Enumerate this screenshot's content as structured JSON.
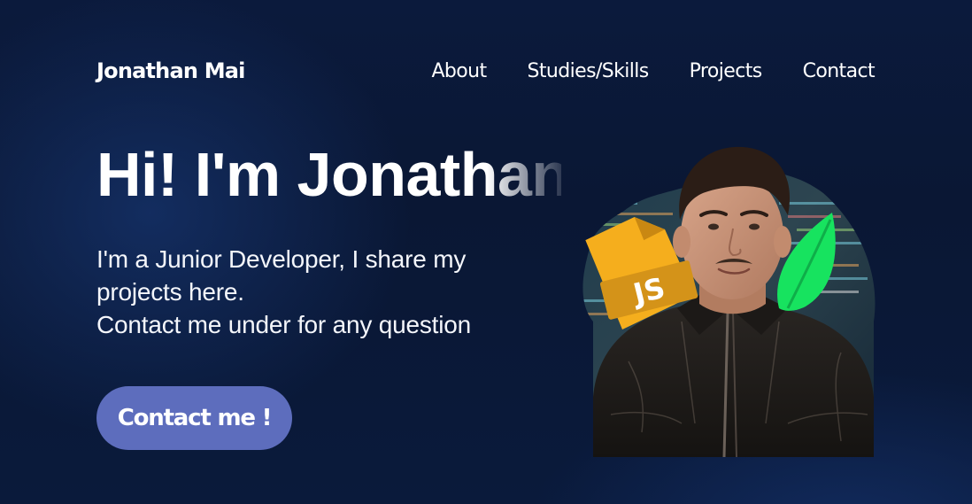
{
  "header": {
    "brand": "Jonathan Mai",
    "nav": [
      {
        "label": "About"
      },
      {
        "label": "Studies/Skills"
      },
      {
        "label": "Projects"
      },
      {
        "label": "Contact"
      }
    ]
  },
  "hero": {
    "title": "Hi! I'm Jonathan",
    "description_lines": [
      "I'm a Junior Developer, I share my",
      "projects here.",
      "Contact me under for any question"
    ],
    "cta_label": "Contact me !"
  },
  "profile": {
    "badge_js_text": "JS",
    "icons": [
      "javascript-file-icon",
      "leaf-icon"
    ]
  },
  "colors": {
    "background": "#0a1734",
    "button": "#5d6dbd",
    "js_badge": "#f5ae1d",
    "leaf": "#17e35f"
  }
}
